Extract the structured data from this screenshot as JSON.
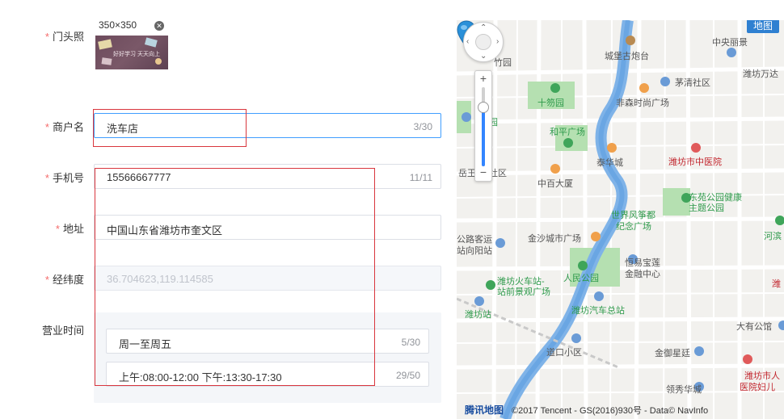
{
  "form": {
    "storefront_label": "门头照",
    "thumb_size": "350×350",
    "thumb_text": "好好学习 天天向上",
    "merchant_label": "商户名",
    "merchant_value": "洗车店",
    "merchant_count": "3/30",
    "phone_label": "手机号",
    "phone_value": "15566667777",
    "phone_count": "11/11",
    "address_label": "地址",
    "address_value": "中国山东省潍坊市奎文区",
    "coords_label": "经纬度",
    "coords_value": "36.704623,119.114585",
    "hours_label": "营业时间",
    "hours_days_value": "周一至周五",
    "hours_days_count": "5/30",
    "hours_time_value": "上午:08:00-12:00 下午:13:30-17:30",
    "hours_time_count": "29/50",
    "required_mark": "*"
  },
  "map": {
    "type_button": "地图",
    "zoom_in": "+",
    "zoom_out": "−",
    "zoom_level": 0.75,
    "attribution_logo": "腾讯地图",
    "attribution_text": "©2017 Tencent - GS(2016)930号 - Data© NavInfo",
    "labels": {
      "zhongyang": "中央丽景",
      "chengbao": "城堡古炮台",
      "weifangwanda": "潍坊万达",
      "zhuxing": "竹园",
      "shijiyuan": "十笏园",
      "maoqing": "茅清社区",
      "feisen": "非森时尚广场",
      "heping": "和平广场",
      "yuan": "园",
      "taihua": "泰华城",
      "zhongyiyuan": "潍坊市中医院",
      "yuewang": "岳王",
      "shequ": "社区",
      "zhongbai": "中百大厦",
      "shijie": "世界风筝都",
      "jinian": "纪念广场",
      "dongyuan": "东苑公园健康",
      "zhuti": "主题公园",
      "hebin": "河滨",
      "gongluke": "公路客运",
      "zhanxiang": "站向阳站",
      "jinsha": "金沙城市广场",
      "renmin": "人民公园",
      "hengyi": "恒易宝莲",
      "jinrong": "金融中心",
      "wei": "潍",
      "huoche": "潍坊火车站-",
      "qianjing": "站前景观广场",
      "weifangzhan": "潍坊站",
      "qiche": "潍坊汽车总站",
      "dayou": "大有公馆",
      "daokou": "道口小区",
      "jinmei": "金御星廷",
      "rennin2": "潍坊市人",
      "fuyou": "医院妇儿",
      "lingxiu": "领秀华城"
    }
  }
}
